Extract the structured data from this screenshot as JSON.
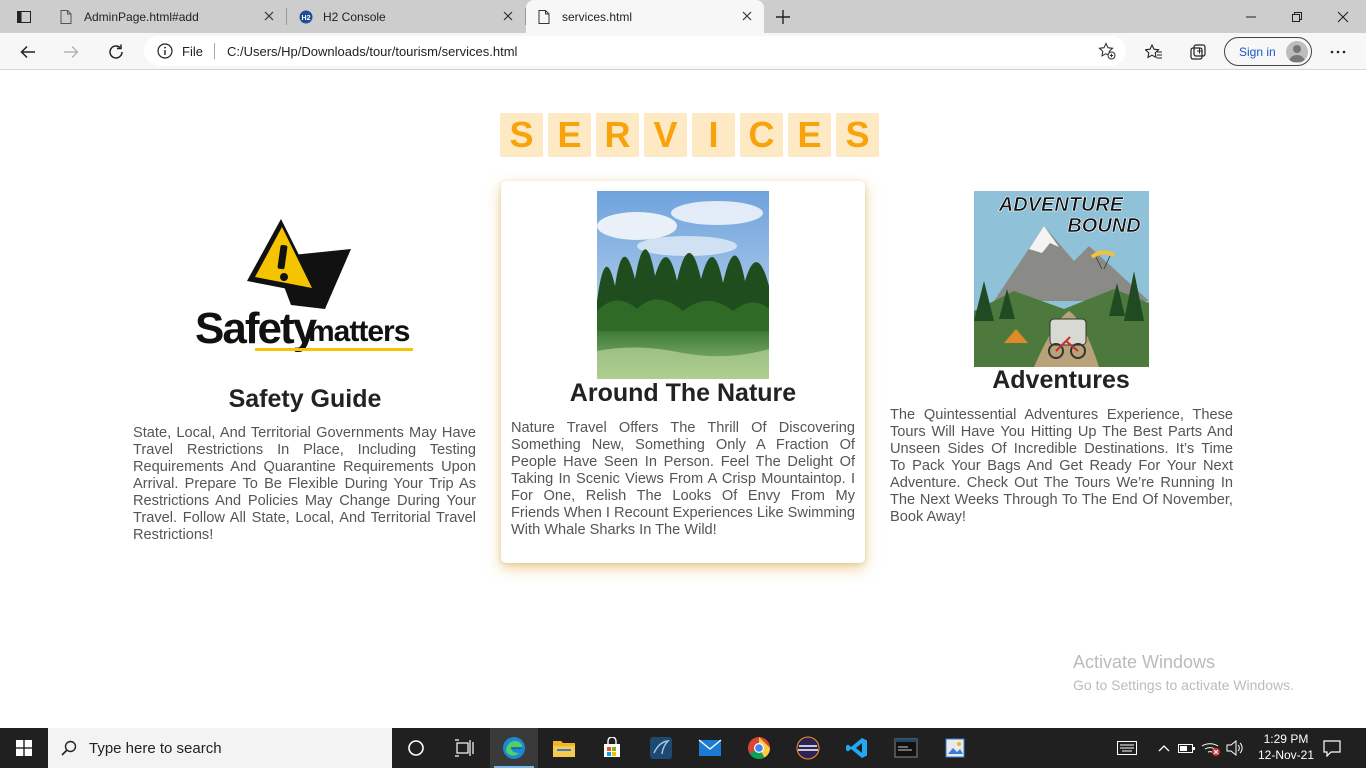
{
  "browser": {
    "tabs": [
      {
        "label": "AdminPage.html#add",
        "active": false
      },
      {
        "label": "H2 Console",
        "active": false
      },
      {
        "label": "services.html",
        "active": true
      }
    ],
    "address": {
      "scheme_label": "File",
      "url": "C:/Users/Hp/Downloads/tour/tourism/services.html"
    },
    "signin_label": "Sign in"
  },
  "page": {
    "title_letters": [
      "S",
      "E",
      "R",
      "V",
      "I",
      "C",
      "E",
      "S"
    ],
    "services": [
      {
        "title": "Safety Guide",
        "image_text_1": "Safety",
        "image_text_2": "matters",
        "text": "State, Local, And Territorial Governments May Have Travel Restrictions In Place, Including Testing Requirements And Quarantine Requirements Upon Arrival. Prepare To Be Flexible During Your Trip As Restrictions And Policies May Change During Your Travel. Follow All State, Local, And Territorial Travel Restrictions!"
      },
      {
        "title": "Around The Nature",
        "text": "Nature Travel Offers The Thrill Of Discovering Something New, Something Only A Fraction Of People Have Seen In Person. Feel The Delight Of Taking In Scenic Views From A Crisp Mountaintop. I For One, Relish The Looks Of Envy From My Friends When I Recount Experiences Like Swimming With Whale Sharks In The Wild!"
      },
      {
        "title": "Adventures",
        "image_text_1": "ADVENTURE",
        "image_text_2": "BOUND",
        "text": "The Quintessential Adventures Experience, These Tours Will Have You Hitting Up The Best Parts And Unseen Sides Of Incredible Destinations. It’s Time To Pack Your Bags And Get Ready For Your Next Adventure. Check Out The Tours We’re Running In The Next Weeks Through To The End Of November, Book Away!"
      }
    ]
  },
  "watermark": {
    "line1": "Activate Windows",
    "line2": "Go to Settings to activate Windows."
  },
  "taskbar": {
    "search_placeholder": "Type here to search",
    "time": "1:29 PM",
    "date": "12-Nov-21"
  },
  "colors": {
    "accent_orange": "#f8a30c",
    "title_tile_bg": "#fde9c4",
    "card_glow": "#e2aa37"
  }
}
